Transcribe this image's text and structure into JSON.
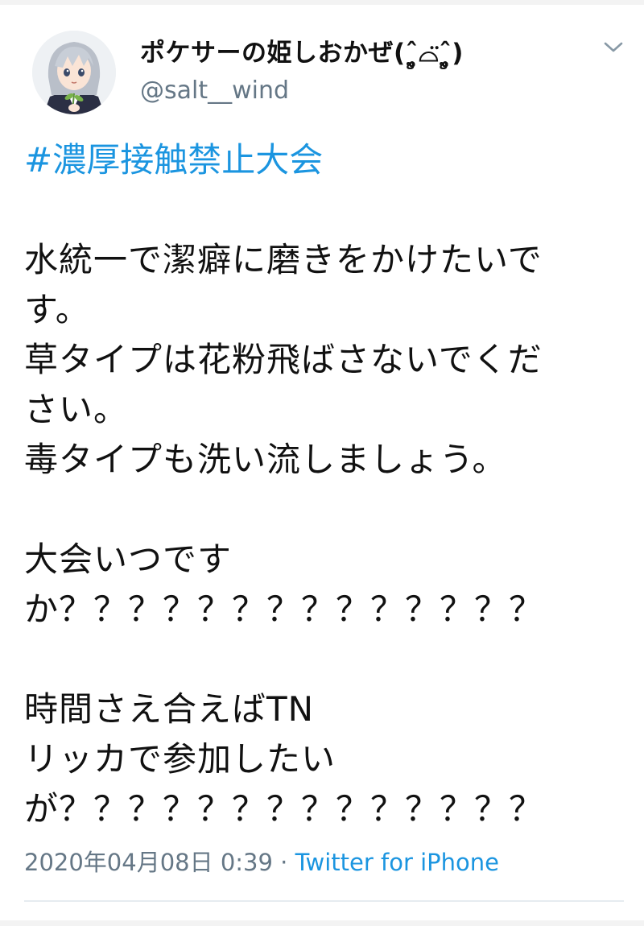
{
  "tweet": {
    "author": {
      "display_name": "ポケサーの姫しおかぜ(ˆູ̥̥̥̥⌓̈ˆູ̥̥̥̥)",
      "handle": "@salt__wind",
      "avatar_icon": "anime-avatar-icon"
    },
    "menu_icon": "chevron-down-icon",
    "hashtag": "#濃厚接触禁止大会",
    "paragraphs": [
      [
        "水統一で潔癖に磨きをかけたいで",
        "す。",
        "草タイプは花粉飛ばさないでくだ",
        "さい。",
        "毒タイプも洗い流しましょう。"
      ],
      [
        "大会いつです",
        "か？？？？？？？？？？？？？？"
      ],
      [
        "時間さえ合えばTN",
        "リッカで参加したい",
        "が？？？？？？？？？？？？？？"
      ]
    ],
    "timestamp": "2020年04月08日 0:39",
    "separator": " · ",
    "source": "Twitter for iPhone",
    "colors": {
      "link": "#1b95e0",
      "secondary_text": "#657786",
      "divider": "#e6ecf0"
    }
  }
}
